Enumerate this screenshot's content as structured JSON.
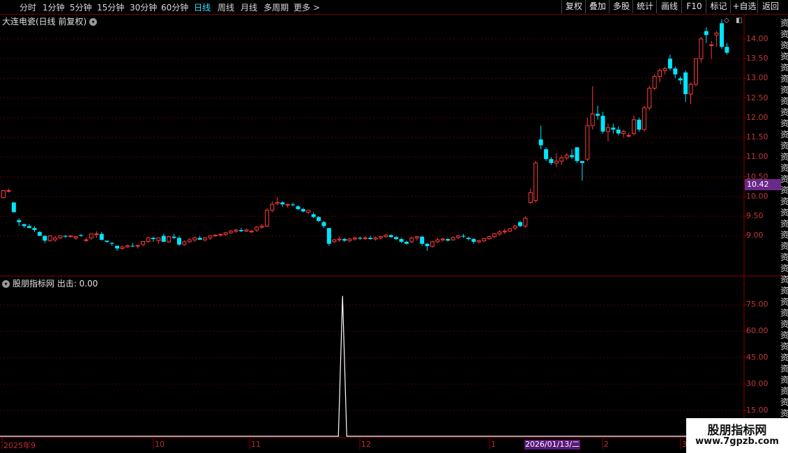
{
  "toolbar": {
    "periods": [
      "分时",
      "1分钟",
      "5分钟",
      "15分钟",
      "30分钟",
      "60分钟",
      "日线",
      "周线",
      "月线",
      "多周期",
      "更多 >"
    ],
    "active_period": "日线",
    "buttons": [
      "复权",
      "叠加",
      "多股",
      "统计",
      "画线",
      "F10",
      "标记",
      "+自选",
      "返回"
    ]
  },
  "chart": {
    "title": "大连电瓷(日线 前复权)",
    "current_price": "10.42",
    "price_ticks": [
      "14.00",
      "13.50",
      "13.00",
      "12.50",
      "12.00",
      "11.50",
      "11.00",
      "10.50",
      "10.00",
      "9.50",
      "9.00"
    ],
    "up_color": "#ff3b3b",
    "down_color": "#00e5ff"
  },
  "indicator": {
    "title": "股朋指标网 出击: 0.00",
    "ticks": [
      "75.00",
      "60.00",
      "45.00",
      "30.00",
      "15.00"
    ]
  },
  "date_axis": {
    "labels": [
      "2025年9",
      "10",
      "11",
      "12",
      "1",
      "2",
      "3"
    ],
    "cursor": "2026/01/13/二"
  },
  "side_glyphs": [
    "资",
    "资",
    "资",
    "资",
    "资",
    "资",
    "资",
    "资",
    "资",
    "资",
    "资",
    "资",
    "资",
    "资",
    "资",
    "资",
    "资",
    "资",
    "资",
    "资",
    "资",
    "资",
    "资",
    "资",
    "资",
    "资",
    "资",
    "资",
    "资",
    "资",
    "资",
    "资",
    "资",
    "资",
    "资",
    "资",
    "资"
  ],
  "watermark": {
    "title": "股朋指标网",
    "url": "www.7gpzb.com"
  },
  "chart_data": {
    "type": "candlestick",
    "candles": [
      [
        9.97,
        10.15,
        9.95,
        10.15
      ],
      [
        10.15,
        10.2,
        10.1,
        10.15
      ],
      [
        9.85,
        9.85,
        9.6,
        9.6
      ],
      [
        9.4,
        9.45,
        9.25,
        9.35
      ],
      [
        9.3,
        9.3,
        9.2,
        9.25
      ],
      [
        9.25,
        9.3,
        9.2,
        9.2
      ],
      [
        9.2,
        9.25,
        9.1,
        9.15
      ],
      [
        9.1,
        9.12,
        9.0,
        9.0
      ],
      [
        9.0,
        9.02,
        8.82,
        8.88
      ],
      [
        8.88,
        9.02,
        8.85,
        9.0
      ],
      [
        8.9,
        9.0,
        8.85,
        8.95
      ],
      [
        8.95,
        9.02,
        8.92,
        9.0
      ],
      [
        9.0,
        9.02,
        8.95,
        8.98
      ],
      [
        8.98,
        9.02,
        8.96,
        9.0
      ],
      [
        8.95,
        9.0,
        8.9,
        8.98
      ],
      [
        9.02,
        9.05,
        8.98,
        9.0
      ],
      [
        8.9,
        8.95,
        8.85,
        8.9
      ],
      [
        8.95,
        9.05,
        8.9,
        9.05
      ],
      [
        9.05,
        9.12,
        8.95,
        9.05
      ],
      [
        9.05,
        9.1,
        8.88,
        8.9
      ],
      [
        8.88,
        8.88,
        8.82,
        8.85
      ],
      [
        8.82,
        8.84,
        8.75,
        8.8
      ],
      [
        8.75,
        8.75,
        8.62,
        8.68
      ],
      [
        8.68,
        8.75,
        8.65,
        8.72
      ],
      [
        8.72,
        8.78,
        8.7,
        8.75
      ],
      [
        8.75,
        8.82,
        8.72,
        8.74
      ],
      [
        8.74,
        8.78,
        8.68,
        8.76
      ],
      [
        8.78,
        8.86,
        8.74,
        8.86
      ],
      [
        8.86,
        8.98,
        8.82,
        8.95
      ],
      [
        8.95,
        8.98,
        8.85,
        8.92
      ],
      [
        8.88,
        8.95,
        8.8,
        8.95
      ],
      [
        9.0,
        9.05,
        8.85,
        8.85
      ],
      [
        8.85,
        9.0,
        8.82,
        8.98
      ],
      [
        8.98,
        9.05,
        8.92,
        8.95
      ],
      [
        8.95,
        9.0,
        8.75,
        8.78
      ],
      [
        8.78,
        8.88,
        8.75,
        8.85
      ],
      [
        8.85,
        8.95,
        8.82,
        8.9
      ],
      [
        8.9,
        8.98,
        8.85,
        8.95
      ],
      [
        8.95,
        9.0,
        8.9,
        8.9
      ],
      [
        8.9,
        8.97,
        8.86,
        8.95
      ],
      [
        8.95,
        9.02,
        8.9,
        9.0
      ],
      [
        9.0,
        9.04,
        8.98,
        9.02
      ],
      [
        9.02,
        9.06,
        8.98,
        9.04
      ],
      [
        9.04,
        9.1,
        9.0,
        9.08
      ],
      [
        9.08,
        9.15,
        9.05,
        9.12
      ],
      [
        9.12,
        9.18,
        9.08,
        9.15
      ],
      [
        9.15,
        9.2,
        9.1,
        9.12
      ],
      [
        9.12,
        9.18,
        9.1,
        9.15
      ],
      [
        9.1,
        9.15,
        9.08,
        9.12
      ],
      [
        9.15,
        9.25,
        9.1,
        9.22
      ],
      [
        9.22,
        9.3,
        9.18,
        9.25
      ],
      [
        9.25,
        9.7,
        9.22,
        9.65
      ],
      [
        9.65,
        9.88,
        9.6,
        9.8
      ],
      [
        9.82,
        9.98,
        9.78,
        9.85
      ],
      [
        9.85,
        9.88,
        9.74,
        9.8
      ],
      [
        9.78,
        9.82,
        9.72,
        9.8
      ],
      [
        9.8,
        9.85,
        9.75,
        9.78
      ],
      [
        9.75,
        9.78,
        9.65,
        9.68
      ],
      [
        9.68,
        9.72,
        9.6,
        9.62
      ],
      [
        9.6,
        9.66,
        9.55,
        9.65
      ],
      [
        9.55,
        9.6,
        9.45,
        9.48
      ],
      [
        9.48,
        9.5,
        9.35,
        9.38
      ],
      [
        9.35,
        9.38,
        9.2,
        9.25
      ],
      [
        9.2,
        9.2,
        8.75,
        8.8
      ],
      [
        8.85,
        8.92,
        8.82,
        8.9
      ],
      [
        8.9,
        8.98,
        8.85,
        8.92
      ],
      [
        8.92,
        8.95,
        8.85,
        8.88
      ],
      [
        8.88,
        8.95,
        8.84,
        8.92
      ],
      [
        8.92,
        8.98,
        8.88,
        8.95
      ],
      [
        8.95,
        8.98,
        8.9,
        8.93
      ],
      [
        8.93,
        9.0,
        8.9,
        8.95
      ],
      [
        8.95,
        9.0,
        8.9,
        8.92
      ],
      [
        8.92,
        8.98,
        8.88,
        8.95
      ],
      [
        8.95,
        9.0,
        8.92,
        8.98
      ],
      [
        8.98,
        9.05,
        8.95,
        9.02
      ],
      [
        9.02,
        9.04,
        8.95,
        8.97
      ],
      [
        8.97,
        9.0,
        8.9,
        8.92
      ],
      [
        8.92,
        8.95,
        8.82,
        8.85
      ],
      [
        8.85,
        8.88,
        8.78,
        8.8
      ],
      [
        8.85,
        8.98,
        8.82,
        8.95
      ],
      [
        8.95,
        9.0,
        8.88,
        8.98
      ],
      [
        8.98,
        9.0,
        8.75,
        8.8
      ],
      [
        8.8,
        8.82,
        8.62,
        8.74
      ],
      [
        8.74,
        8.88,
        8.7,
        8.85
      ],
      [
        8.85,
        8.95,
        8.82,
        8.9
      ],
      [
        8.9,
        8.95,
        8.85,
        8.92
      ],
      [
        8.92,
        8.95,
        8.86,
        8.88
      ],
      [
        8.9,
        8.98,
        8.88,
        8.96
      ],
      [
        8.96,
        9.02,
        8.92,
        9.0
      ],
      [
        9.0,
        9.05,
        8.95,
        8.98
      ],
      [
        8.95,
        8.98,
        8.88,
        8.92
      ],
      [
        8.92,
        8.95,
        8.8,
        8.85
      ],
      [
        8.85,
        8.9,
        8.8,
        8.88
      ],
      [
        8.88,
        8.95,
        8.84,
        8.93
      ],
      [
        8.93,
        9.0,
        8.9,
        8.98
      ],
      [
        8.98,
        9.08,
        8.95,
        9.05
      ],
      [
        9.05,
        9.15,
        9.0,
        9.1
      ],
      [
        9.1,
        9.18,
        9.05,
        9.12
      ],
      [
        9.12,
        9.2,
        9.1,
        9.18
      ],
      [
        9.2,
        9.28,
        9.15,
        9.25
      ],
      [
        9.35,
        9.38,
        9.22,
        9.25
      ],
      [
        9.25,
        9.5,
        9.2,
        9.45
      ],
      [
        9.85,
        10.2,
        9.82,
        10.1
      ],
      [
        9.9,
        10.9,
        9.85,
        10.85
      ],
      [
        11.45,
        11.8,
        11.2,
        11.3
      ],
      [
        11.2,
        11.25,
        10.9,
        10.95
      ],
      [
        10.95,
        11.0,
        10.8,
        10.85
      ],
      [
        10.85,
        11.1,
        10.75,
        10.9
      ],
      [
        10.9,
        11.05,
        10.8,
        10.98
      ],
      [
        10.98,
        11.1,
        10.92,
        11.05
      ],
      [
        11.05,
        11.2,
        10.95,
        11.0
      ],
      [
        11.25,
        11.25,
        10.85,
        10.9
      ],
      [
        10.9,
        10.9,
        10.4,
        10.85
      ],
      [
        10.95,
        12.0,
        10.9,
        11.8
      ],
      [
        11.8,
        12.8,
        11.7,
        12.1
      ],
      [
        12.1,
        12.3,
        11.95,
        12.05
      ],
      [
        12.05,
        12.15,
        11.6,
        11.65
      ],
      [
        11.65,
        11.85,
        11.4,
        11.75
      ],
      [
        11.75,
        11.85,
        11.6,
        11.7
      ],
      [
        11.7,
        11.78,
        11.55,
        11.6
      ],
      [
        11.6,
        11.7,
        11.5,
        11.65
      ],
      [
        11.55,
        11.62,
        11.5,
        11.55
      ],
      [
        11.6,
        12.05,
        11.55,
        11.95
      ],
      [
        11.95,
        12.0,
        11.65,
        11.7
      ],
      [
        11.7,
        12.3,
        11.65,
        12.25
      ],
      [
        12.25,
        12.8,
        12.2,
        12.75
      ],
      [
        12.75,
        13.1,
        12.7,
        13.05
      ],
      [
        13.05,
        13.25,
        12.9,
        13.2
      ],
      [
        13.2,
        13.3,
        13.1,
        13.25
      ],
      [
        13.5,
        13.6,
        13.2,
        13.25
      ],
      [
        13.25,
        13.3,
        13.0,
        13.1
      ],
      [
        13.0,
        13.05,
        12.85,
        12.95
      ],
      [
        13.15,
        13.2,
        12.4,
        12.6
      ],
      [
        12.6,
        12.9,
        12.35,
        12.85
      ],
      [
        12.85,
        13.5,
        12.8,
        13.5
      ],
      [
        13.5,
        14.05,
        13.4,
        14.0
      ],
      [
        14.2,
        14.3,
        13.9,
        14.1
      ],
      [
        13.85,
        13.95,
        13.5,
        13.85
      ],
      [
        14.1,
        14.2,
        13.8,
        14.15
      ],
      [
        14.4,
        14.5,
        13.75,
        13.8
      ],
      [
        13.8,
        13.9,
        13.6,
        13.65
      ]
    ],
    "ylim": [
      8.0,
      14.6
    ],
    "indicator_series": {
      "name": "出击",
      "peak_index": 64,
      "peak_value": 80,
      "ylim": [
        0,
        85
      ]
    }
  }
}
